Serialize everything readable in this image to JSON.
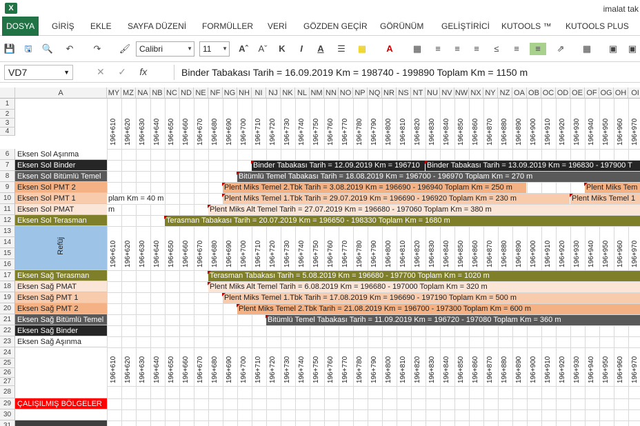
{
  "titlebar": {
    "app_icon": "X",
    "title": "imalat tak"
  },
  "ribbon": {
    "tabs": [
      "DOSYA",
      "GİRİŞ",
      "EKLE",
      "SAYFA DÜZENİ",
      "FORMÜLLER",
      "VERİ",
      "GÖZDEN GEÇİR",
      "GÖRÜNÜM",
      "GELİŞTİRİCİ",
      "KUTOOLS ™",
      "KUTOOLS PLUS"
    ],
    "active": "DOSYA"
  },
  "toolbar": {
    "font": "Calibri",
    "size": "11",
    "bold": "K",
    "italic": "I",
    "underline": "A"
  },
  "formula_bar": {
    "name_box": "VD7",
    "fx": "fx",
    "formula": "Binder Tabakası Tarih = 16.09.2019  Km = 198740 - 199890 Toplam Km = 1150 m"
  },
  "grid": {
    "col_a": "A",
    "columns": [
      "MY",
      "MZ",
      "NA",
      "NB",
      "NC",
      "ND",
      "NE",
      "NF",
      "NG",
      "NH",
      "NI",
      "NJ",
      "NK",
      "NL",
      "NM",
      "NN",
      "NO",
      "NP",
      "NQ",
      "NR",
      "NS",
      "NT",
      "NU",
      "NV",
      "NW",
      "NX",
      "NY",
      "NZ",
      "OA",
      "OB",
      "OC",
      "OD",
      "OE",
      "OF",
      "OG",
      "OH",
      "OI"
    ],
    "stations": [
      "196+610",
      "196+620",
      "196+630",
      "196+640",
      "196+650",
      "196+660",
      "196+670",
      "196+680",
      "196+690",
      "196+700",
      "196+710",
      "196+720",
      "196+730",
      "196+740",
      "196+750",
      "196+760",
      "196+770",
      "196+780",
      "196+790",
      "196+800",
      "196+810",
      "196+820",
      "196+830",
      "196+840",
      "196+850",
      "196+860",
      "196+870",
      "196+880",
      "196+890",
      "196+900",
      "196+910",
      "196+920",
      "196+930",
      "196+940",
      "196+950",
      "196+960",
      "196+970"
    ],
    "row_numbers": [
      "1",
      "2",
      "3",
      "4",
      "6",
      "7",
      "8",
      "9",
      "10",
      "11",
      "12",
      "13",
      "14",
      "15",
      "16",
      "17",
      "18",
      "19",
      "20",
      "21",
      "22",
      "23",
      "24",
      "25",
      "26",
      "27",
      "28",
      "29",
      "30",
      "31"
    ],
    "labels": {
      "r6": "Eksen Sol Aşınma",
      "r7": "Eksen Sol Binder",
      "r8": "Eksen Sol Bitümlü Temel",
      "r9": "Eksen Sol PMT 2",
      "r10": "Eksen Sol PMT 1",
      "r11": "Eksen Sol PMAT",
      "r12": "Eksen Sol Terasman",
      "refuj": "Refüj",
      "r17": "Eksen Sağ Terasman",
      "r18": "Eksen Sağ PMAT",
      "r19": "Eksen Sağ PMT 1",
      "r20": "Eksen Sağ PMT 2",
      "r21": "Eksen Sağ Bitümlü Temel",
      "r22": "Eksen Sağ Binder",
      "r23": "Eksen Sağ Aşınma",
      "r29": "ÇALIŞILMIŞ BÖLGELER"
    },
    "bars": {
      "r7a": "Binder Tabakası Tarih = 12.09.2019  Km = 196710",
      "r7b": "Binder Tabakası Tarih = 13.09.2019  Km = 196830 - 197900 T",
      "r8": "Bitümlü Temel Tabakası Tarih = 18.08.2019  Km = 196700 - 196970 Toplam Km = 270 m",
      "r9a": "Plent Miks Temel 2.Tbk Tarih = 3.08.2019  Km = 196690 - 196940 Toplam Km = 250 m",
      "r9b": "Plent Miks Tem",
      "r10pre": "plam Km = 40 m",
      "r10a": "Plent Miks Temel 1.Tbk Tarih = 29.07.2019  Km = 196690 - 196920 Toplam Km = 230 m",
      "r10b": "Plent Miks Temel 1",
      "r11pre": "m",
      "r11": "Plent Miks Alt Temel Tarih = 27.07.2019  Km = 196680 - 197060 Toplam Km = 380 m",
      "r12": "Terasman Tabakası Tarih = 20.07.2019  Km = 196650 - 198330 Toplam Km = 1680 m",
      "r17": "Terasman Tabakası Tarih = 5.08.2019  Km = 196680 - 197700 Toplam Km = 1020 m",
      "r18": "Plent Miks Alt Temel Tarih = 6.08.2019  Km = 196680 - 197000 Toplam Km = 320 m",
      "r19": "Plent Miks Temel 1.Tbk Tarih = 17.08.2019  Km = 196690 - 197190 Toplam Km = 500 m",
      "r20": "Plent Miks Temel 2.Tbk Tarih = 21.08.2019  Km = 196700 - 197300 Toplam Km = 600 m",
      "r21": "Bitümlü Temel Tabakası Tarih = 11.09.2019  Km = 196720 - 197080 Toplam Km = 360 m"
    }
  },
  "colors": {
    "dark": "#3f3f3f",
    "binder": "#262626",
    "bitumlu": "#595959",
    "pmt2": "#f4b183",
    "pmt1": "#f8cbad",
    "pmat": "#fbe5d6",
    "terasman": "#7f7f2a",
    "refuj": "#9dc3e6",
    "red": "#ff0000",
    "green": "#217346"
  }
}
